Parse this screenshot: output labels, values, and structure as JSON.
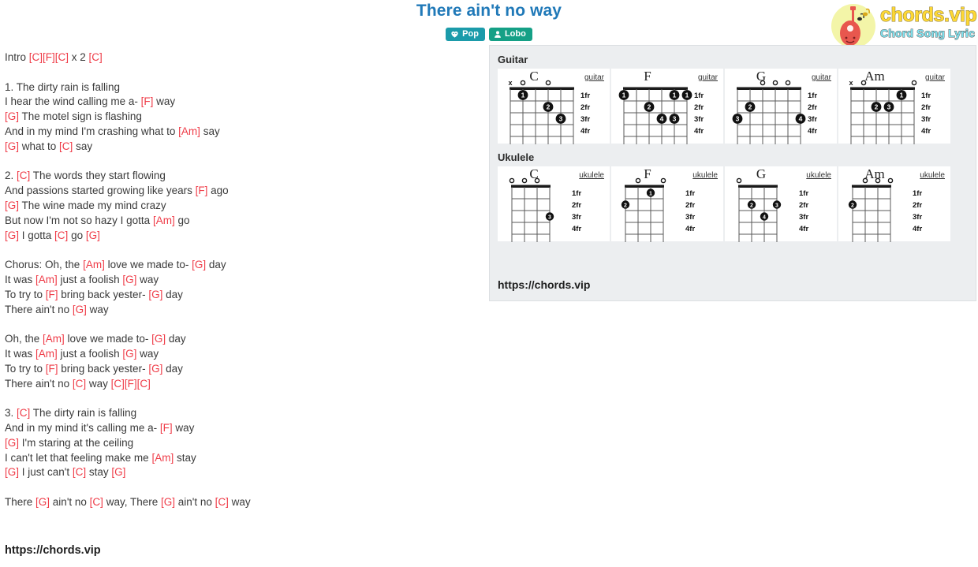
{
  "header": {
    "title": "There ain't no way",
    "badges": [
      {
        "name": "genre-badge",
        "icon": "genre-icon",
        "label": "Pop"
      },
      {
        "name": "artist-badge",
        "icon": "user-icon",
        "label": "Lobo"
      }
    ]
  },
  "logo": {
    "main": "chords.vip",
    "sub": "Chord Song Lyric",
    "icon": "guitar-icon"
  },
  "lyrics": {
    "lines": [
      [
        {
          "t": "Intro ",
          "c": false
        },
        {
          "t": "[C][F][C]",
          "c": true
        },
        {
          "t": " x 2 ",
          "c": false
        },
        {
          "t": "[C]",
          "c": true
        }
      ],
      [],
      [
        {
          "t": "1. The dirty rain is falling",
          "c": false
        }
      ],
      [
        {
          "t": "I hear the wind calling me a- ",
          "c": false
        },
        {
          "t": "[F]",
          "c": true
        },
        {
          "t": " way",
          "c": false
        }
      ],
      [
        {
          "t": "[G]",
          "c": true
        },
        {
          "t": " The motel sign is flashing",
          "c": false
        }
      ],
      [
        {
          "t": "And in my mind I'm crashing what to ",
          "c": false
        },
        {
          "t": "[Am]",
          "c": true
        },
        {
          "t": " say",
          "c": false
        }
      ],
      [
        {
          "t": "[G]",
          "c": true
        },
        {
          "t": " what to ",
          "c": false
        },
        {
          "t": "[C]",
          "c": true
        },
        {
          "t": " say",
          "c": false
        }
      ],
      [],
      [
        {
          "t": "2. ",
          "c": false
        },
        {
          "t": "[C]",
          "c": true
        },
        {
          "t": " The words they start flowing",
          "c": false
        }
      ],
      [
        {
          "t": "And passions started growing like years ",
          "c": false
        },
        {
          "t": "[F]",
          "c": true
        },
        {
          "t": " ago",
          "c": false
        }
      ],
      [
        {
          "t": "[G]",
          "c": true
        },
        {
          "t": " The wine made my mind crazy",
          "c": false
        }
      ],
      [
        {
          "t": "But now I'm not so hazy I gotta ",
          "c": false
        },
        {
          "t": "[Am]",
          "c": true
        },
        {
          "t": " go",
          "c": false
        }
      ],
      [
        {
          "t": "[G]",
          "c": true
        },
        {
          "t": " I gotta ",
          "c": false
        },
        {
          "t": "[C]",
          "c": true
        },
        {
          "t": " go ",
          "c": false
        },
        {
          "t": "[G]",
          "c": true
        }
      ],
      [],
      [
        {
          "t": "Chorus: Oh, the ",
          "c": false
        },
        {
          "t": "[Am]",
          "c": true
        },
        {
          "t": " love we made to- ",
          "c": false
        },
        {
          "t": "[G]",
          "c": true
        },
        {
          "t": " day",
          "c": false
        }
      ],
      [
        {
          "t": "It was ",
          "c": false
        },
        {
          "t": "[Am]",
          "c": true
        },
        {
          "t": " just a foolish ",
          "c": false
        },
        {
          "t": "[G]",
          "c": true
        },
        {
          "t": " way",
          "c": false
        }
      ],
      [
        {
          "t": "To try to ",
          "c": false
        },
        {
          "t": "[F]",
          "c": true
        },
        {
          "t": " bring back yester- ",
          "c": false
        },
        {
          "t": "[G]",
          "c": true
        },
        {
          "t": " day",
          "c": false
        }
      ],
      [
        {
          "t": "There ain't no ",
          "c": false
        },
        {
          "t": "[G]",
          "c": true
        },
        {
          "t": " way",
          "c": false
        }
      ],
      [],
      [
        {
          "t": "Oh, the ",
          "c": false
        },
        {
          "t": "[Am]",
          "c": true
        },
        {
          "t": " love we made to- ",
          "c": false
        },
        {
          "t": "[G]",
          "c": true
        },
        {
          "t": " day",
          "c": false
        }
      ],
      [
        {
          "t": "It was ",
          "c": false
        },
        {
          "t": "[Am]",
          "c": true
        },
        {
          "t": " just a foolish ",
          "c": false
        },
        {
          "t": "[G]",
          "c": true
        },
        {
          "t": " way",
          "c": false
        }
      ],
      [
        {
          "t": "To try to ",
          "c": false
        },
        {
          "t": "[F]",
          "c": true
        },
        {
          "t": " bring back yester- ",
          "c": false
        },
        {
          "t": "[G]",
          "c": true
        },
        {
          "t": " day",
          "c": false
        }
      ],
      [
        {
          "t": "There ain't no ",
          "c": false
        },
        {
          "t": "[C]",
          "c": true
        },
        {
          "t": " way ",
          "c": false
        },
        {
          "t": "[C][F][C]",
          "c": true
        }
      ],
      [],
      [
        {
          "t": "3. ",
          "c": false
        },
        {
          "t": "[C]",
          "c": true
        },
        {
          "t": " The dirty rain is falling",
          "c": false
        }
      ],
      [
        {
          "t": "And in my mind it's calling me a- ",
          "c": false
        },
        {
          "t": "[F]",
          "c": true
        },
        {
          "t": " way",
          "c": false
        }
      ],
      [
        {
          "t": "[G]",
          "c": true
        },
        {
          "t": " I'm staring at the ceiling",
          "c": false
        }
      ],
      [
        {
          "t": "I can't let that feeling make me ",
          "c": false
        },
        {
          "t": "[Am]",
          "c": true
        },
        {
          "t": " stay",
          "c": false
        }
      ],
      [
        {
          "t": "[G]",
          "c": true
        },
        {
          "t": " I just can't ",
          "c": false
        },
        {
          "t": "[C]",
          "c": true
        },
        {
          "t": " stay ",
          "c": false
        },
        {
          "t": "[G]",
          "c": true
        }
      ],
      [],
      [
        {
          "t": "There ",
          "c": false
        },
        {
          "t": "[G]",
          "c": true
        },
        {
          "t": " ain't no ",
          "c": false
        },
        {
          "t": "[C]",
          "c": true
        },
        {
          "t": " way, There ",
          "c": false
        },
        {
          "t": "[G]",
          "c": true
        },
        {
          "t": " ain't no ",
          "c": false
        },
        {
          "t": "[C]",
          "c": true
        },
        {
          "t": " way",
          "c": false
        }
      ]
    ]
  },
  "footer_url": "https://chords.vip",
  "panel": {
    "url": "https://chords.vip",
    "sections": [
      {
        "title": "Guitar",
        "instrument_label": "guitar",
        "strings": 6,
        "fret_labels": [
          "1fr",
          "2fr",
          "3fr",
          "4fr"
        ],
        "charts": [
          {
            "name": "C",
            "open": [
              {
                "s": 3
              },
              {
                "s": 5
              }
            ],
            "muted": [
              {
                "s": 6
              }
            ],
            "dots": [
              {
                "s": 5,
                "f": 1,
                "finger": "1"
              },
              {
                "s": 3,
                "f": 2,
                "finger": "2"
              },
              {
                "s": 2,
                "f": 3,
                "finger": "3"
              }
            ]
          },
          {
            "name": "F",
            "open": [],
            "muted": [],
            "dots": [
              {
                "s": 6,
                "f": 1,
                "finger": "1"
              },
              {
                "s": 2,
                "f": 1,
                "finger": "1"
              },
              {
                "s": 1,
                "f": 1,
                "finger": "1"
              },
              {
                "s": 4,
                "f": 2,
                "finger": "2"
              },
              {
                "s": 3,
                "f": 3,
                "finger": "4"
              },
              {
                "s": 2,
                "f": 3,
                "finger": "3"
              }
            ]
          },
          {
            "name": "G",
            "open": [
              {
                "s": 4
              },
              {
                "s": 3
              },
              {
                "s": 2
              }
            ],
            "muted": [],
            "dots": [
              {
                "s": 5,
                "f": 2,
                "finger": "2"
              },
              {
                "s": 6,
                "f": 3,
                "finger": "3"
              },
              {
                "s": 1,
                "f": 3,
                "finger": "4"
              }
            ]
          },
          {
            "name": "Am",
            "open": [
              {
                "s": 5
              },
              {
                "s": 1
              }
            ],
            "muted": [
              {
                "s": 6
              }
            ],
            "dots": [
              {
                "s": 2,
                "f": 1,
                "finger": "1"
              },
              {
                "s": 4,
                "f": 2,
                "finger": "2"
              },
              {
                "s": 3,
                "f": 2,
                "finger": "3"
              }
            ]
          }
        ]
      },
      {
        "title": "Ukulele",
        "instrument_label": "ukulele",
        "strings": 4,
        "fret_labels": [
          "1fr",
          "2fr",
          "3fr",
          "4fr"
        ],
        "charts": [
          {
            "name": "C",
            "open": [
              {
                "s": 4
              },
              {
                "s": 3
              },
              {
                "s": 2
              }
            ],
            "muted": [],
            "dots": [
              {
                "s": 1,
                "f": 3,
                "finger": "3"
              }
            ]
          },
          {
            "name": "F",
            "open": [
              {
                "s": 3
              },
              {
                "s": 1
              }
            ],
            "muted": [],
            "dots": [
              {
                "s": 2,
                "f": 1,
                "finger": "1"
              },
              {
                "s": 4,
                "f": 2,
                "finger": "2"
              }
            ]
          },
          {
            "name": "G",
            "open": [
              {
                "s": 4
              }
            ],
            "muted": [],
            "dots": [
              {
                "s": 3,
                "f": 2,
                "finger": "2"
              },
              {
                "s": 1,
                "f": 2,
                "finger": "3"
              },
              {
                "s": 2,
                "f": 3,
                "finger": "4"
              }
            ]
          },
          {
            "name": "Am",
            "open": [
              {
                "s": 3
              },
              {
                "s": 2
              },
              {
                "s": 1
              }
            ],
            "muted": [],
            "dots": [
              {
                "s": 4,
                "f": 2,
                "finger": "2"
              }
            ]
          }
        ]
      }
    ]
  },
  "colors": {
    "title": "#2079b8",
    "chord": "#ef3b47",
    "genre_badge": "#1b9baa",
    "artist_badge": "#15a086",
    "panel_bg": "#eceef0"
  }
}
